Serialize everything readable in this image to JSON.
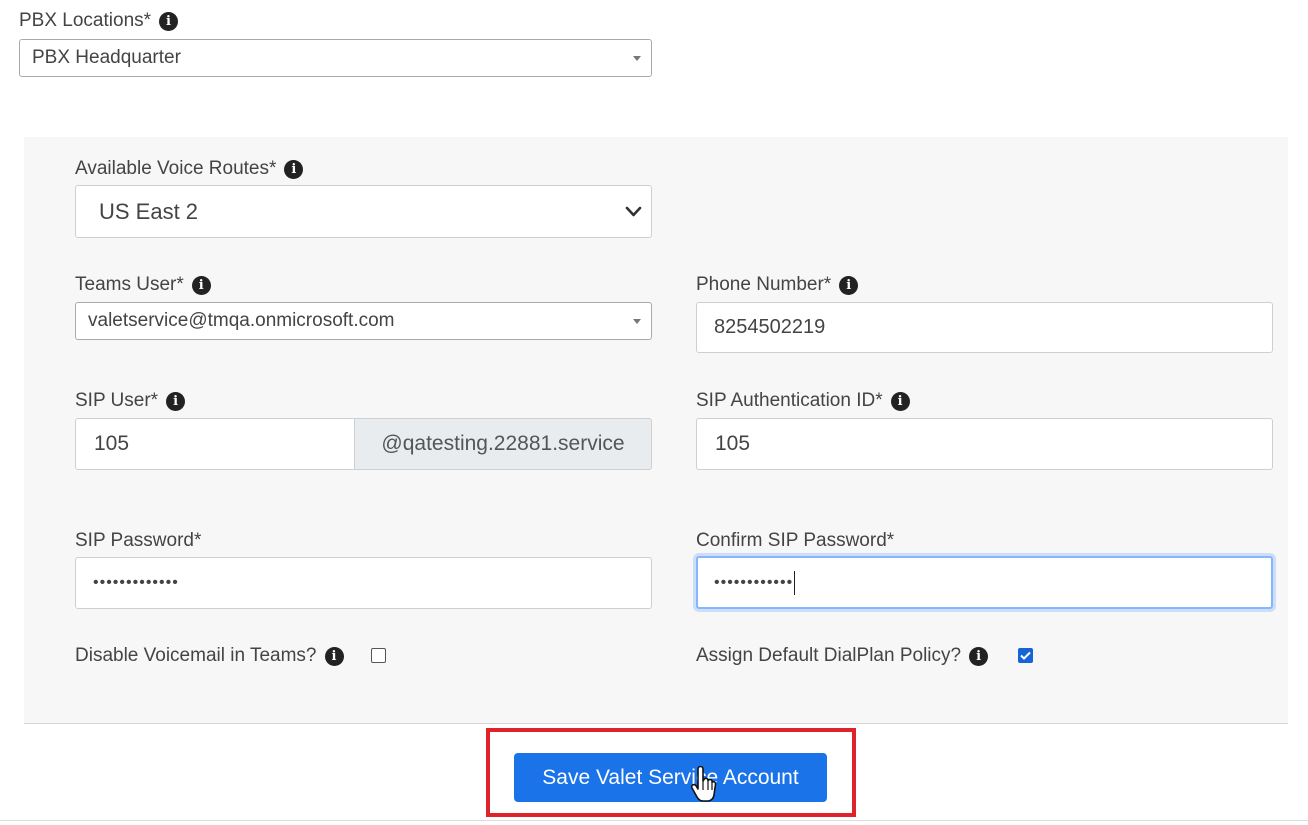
{
  "pbx_locations": {
    "label": "PBX Locations*",
    "value": "PBX Headquarter"
  },
  "voice_routes": {
    "label": "Available Voice Routes*",
    "value": "US East 2"
  },
  "teams_user": {
    "label": "Teams User*",
    "value": "valetservice@tmqa.onmicrosoft.com"
  },
  "phone_number": {
    "label": "Phone Number*",
    "value": "8254502219"
  },
  "sip_user": {
    "label": "SIP User*",
    "value": "105",
    "suffix": "@qatesting.22881.service"
  },
  "sip_auth_id": {
    "label": "SIP Authentication ID*",
    "value": "105"
  },
  "sip_password": {
    "label": "SIP Password*",
    "value": "•••••••••••••"
  },
  "confirm_sip_password": {
    "label": "Confirm SIP Password*",
    "value": "••••••••••••"
  },
  "disable_voicemail": {
    "label": "Disable Voicemail in Teams?",
    "checked": false
  },
  "default_dialplan": {
    "label": "Assign Default DialPlan Policy?",
    "checked": true
  },
  "save_button": {
    "label": "Save Valet Service Account"
  },
  "colors": {
    "primary": "#1a73e8",
    "highlight": "#e0222a",
    "focus": "#86b7fe"
  }
}
